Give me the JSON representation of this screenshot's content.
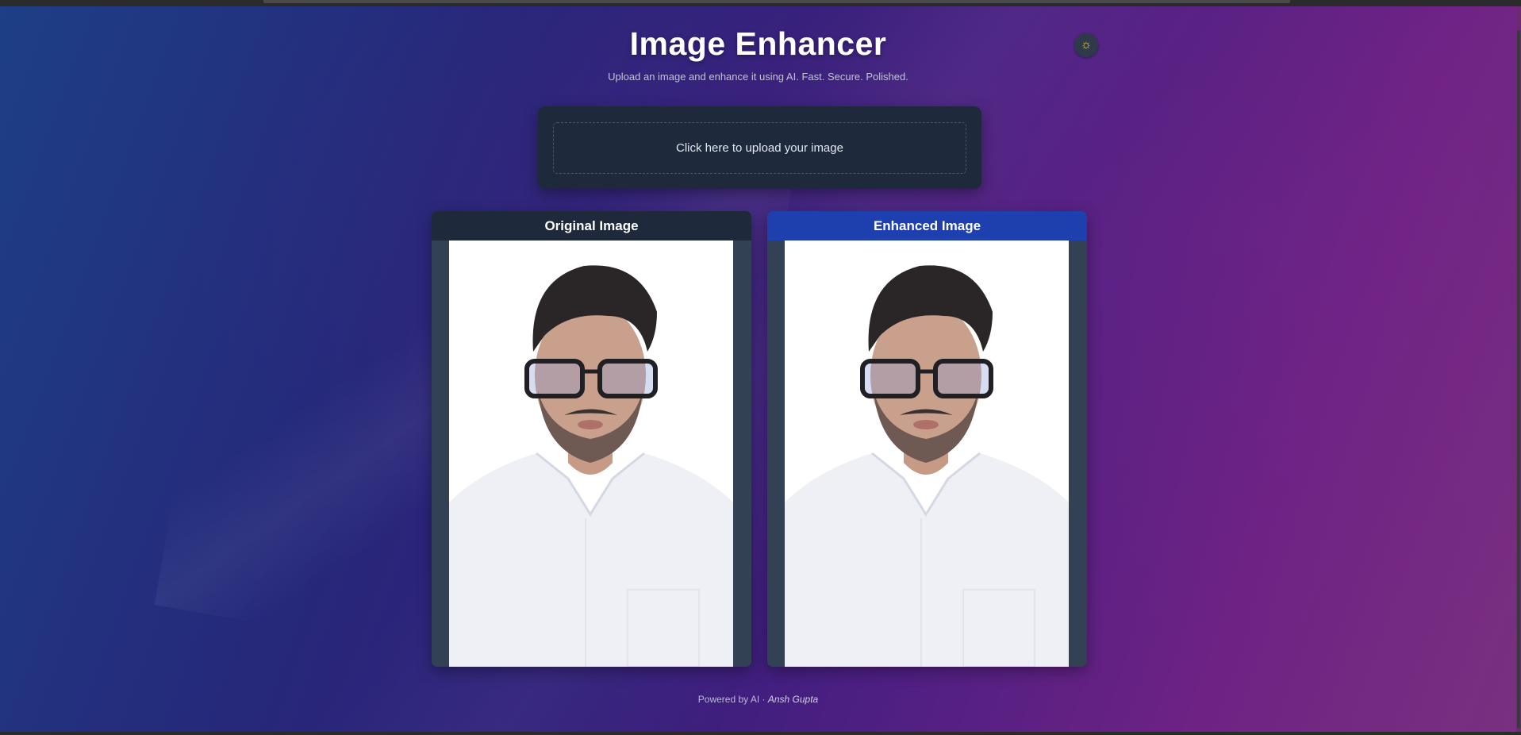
{
  "header": {
    "title": "Image Enhancer",
    "subtitle": "Upload an image and enhance it using AI. Fast. Secure. Polished."
  },
  "theme_toggle": {
    "icon": "sun-icon",
    "glyph": "☼"
  },
  "upload": {
    "label": "Click here to upload your image"
  },
  "panels": {
    "original": {
      "title": "Original Image"
    },
    "enhanced": {
      "title": "Enhanced Image"
    }
  },
  "footer": {
    "prefix": "Powered by AI · ",
    "author": "Ansh Gupta"
  },
  "colors": {
    "panel_header_original": "#1e293b",
    "panel_header_enhanced": "#1e40af",
    "card_background": "#1e293b",
    "sun_icon": "#f4c430"
  }
}
